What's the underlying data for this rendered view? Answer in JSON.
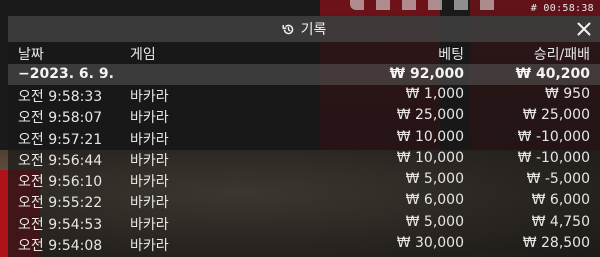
{
  "timer": "# 00:58:38",
  "panel": {
    "title": "기록",
    "history_icon": "history-icon",
    "close_icon": "close-icon"
  },
  "columns": {
    "time": "날짜",
    "game": "게임",
    "bet": "베팅",
    "result": "승리/패배"
  },
  "summary": {
    "date": "−2023. 6. 9.",
    "bet": "₩ 92,000",
    "result": "₩ 40,200"
  },
  "records": [
    {
      "time": "오전 9:58:33",
      "game": "바카라",
      "bet": "₩ 1,000",
      "result": "₩ 950"
    },
    {
      "time": "오전 9:58:07",
      "game": "바카라",
      "bet": "₩ 25,000",
      "result": "₩ 25,000"
    },
    {
      "time": "오전 9:57:21",
      "game": "바카라",
      "bet": "₩ 10,000",
      "result": "₩ -10,000"
    },
    {
      "time": "오전 9:56:44",
      "game": "바카라",
      "bet": "₩ 10,000",
      "result": "₩ -10,000"
    },
    {
      "time": "오전 9:56:10",
      "game": "바카라",
      "bet": "₩ 5,000",
      "result": "₩ -5,000"
    },
    {
      "time": "오전 9:55:22",
      "game": "바카라",
      "bet": "₩ 6,000",
      "result": "₩ 6,000"
    },
    {
      "time": "오전 9:54:53",
      "game": "바카라",
      "bet": "₩ 5,000",
      "result": "₩ 4,750"
    },
    {
      "time": "오전 9:54:08",
      "game": "바카라",
      "bet": "₩ 30,000",
      "result": "₩ 28,500"
    }
  ]
}
